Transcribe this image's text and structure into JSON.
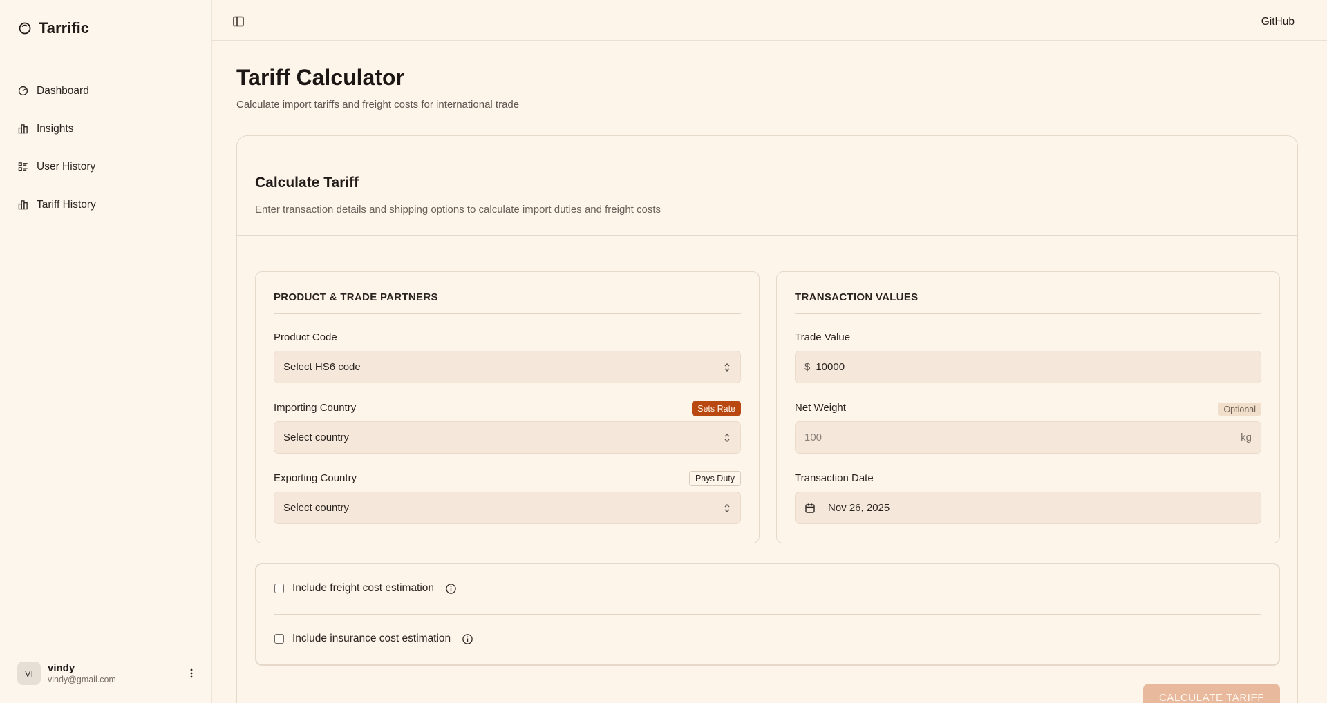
{
  "brand": {
    "name": "Tarrific",
    "icon": "logo-circle-icon"
  },
  "sidebar": {
    "items": [
      {
        "label": "Dashboard",
        "icon": "gauge-icon"
      },
      {
        "label": "Insights",
        "icon": "bar-chart-icon"
      },
      {
        "label": "User History",
        "icon": "list-icon"
      },
      {
        "label": "Tariff History",
        "icon": "bar-chart-icon"
      }
    ]
  },
  "user": {
    "initials": "VI",
    "name": "vindy",
    "email": "vindy@gmail.com"
  },
  "topbar": {
    "github": "GitHub"
  },
  "page": {
    "title": "Tariff Calculator",
    "subtitle": "Calculate import tariffs and freight costs for international trade"
  },
  "card": {
    "title": "Calculate Tariff",
    "description": "Enter transaction details and shipping options to calculate import duties and freight costs"
  },
  "product_panel": {
    "heading": "PRODUCT & TRADE PARTNERS",
    "product_code": {
      "label": "Product Code",
      "value": "Select HS6 code"
    },
    "importing": {
      "label": "Importing Country",
      "badge": "Sets Rate",
      "value": "Select country"
    },
    "exporting": {
      "label": "Exporting Country",
      "badge": "Pays Duty",
      "value": "Select country"
    }
  },
  "transaction_panel": {
    "heading": "TRANSACTION VALUES",
    "trade_value": {
      "label": "Trade Value",
      "currency": "$",
      "value": "10000"
    },
    "net_weight": {
      "label": "Net Weight",
      "badge": "Optional",
      "placeholder": "100",
      "unit": "kg"
    },
    "date": {
      "label": "Transaction Date",
      "value": "Nov 26, 2025"
    }
  },
  "options": {
    "freight": {
      "label": "Include freight cost estimation",
      "checked": false
    },
    "insurance": {
      "label": "Include insurance cost estimation",
      "checked": false
    }
  },
  "actions": {
    "calculate": "CALCULATE TARIFF"
  },
  "colors": {
    "accent": "#b8480f",
    "background": "#fdf5ea",
    "button_disabled": "#e8b99c"
  }
}
